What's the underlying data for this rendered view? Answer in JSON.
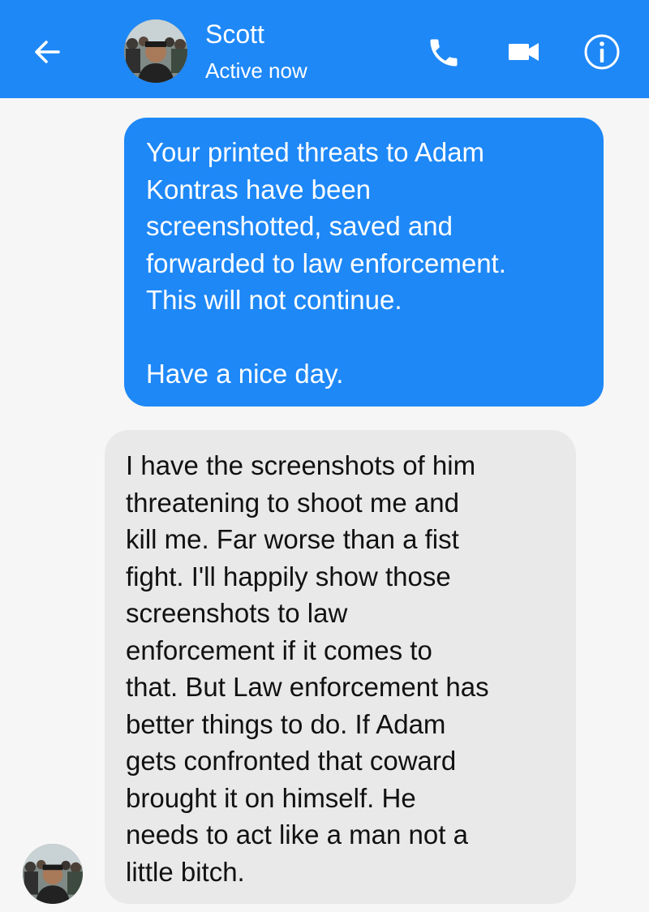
{
  "header": {
    "back_icon": "arrow-left-icon",
    "contact_name": "Scott",
    "status": "Active now",
    "actions": [
      {
        "name": "call",
        "icon": "phone-icon"
      },
      {
        "name": "video",
        "icon": "video-camera-icon"
      },
      {
        "name": "info",
        "icon": "info-circle-icon"
      }
    ]
  },
  "messages": [
    {
      "direction": "outgoing",
      "text": "Your printed threats to Adam\nKontras have been\nscreenshotted, saved and\nforwarded to law enforcement.\nThis will not continue.\n\nHave a nice day."
    },
    {
      "direction": "incoming",
      "text": "I have the screenshots of him\nthreatening to shoot me and\nkill me. Far worse than a fist\nfight. I'll happily show those\nscreenshots to law\nenforcement if it comes to\nthat. But Law enforcement has\nbetter things to do. If Adam\ngets confronted that coward\nbrought it on himself. He\nneeds to act like a man not a\nlittle bitch."
    }
  ],
  "colors": {
    "accent": "#1e88f7",
    "background": "#f6f6f6",
    "incoming_bubble": "#e9e9e9",
    "outgoing_text": "#ffffff",
    "incoming_text": "#111111"
  }
}
